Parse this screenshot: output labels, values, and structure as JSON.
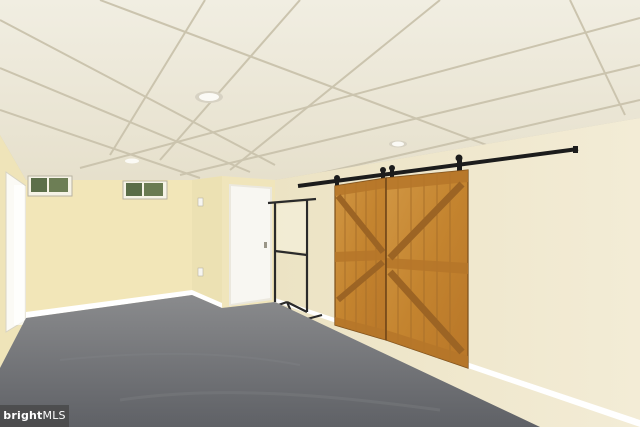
{
  "watermark": {
    "brand": "bright",
    "suffix": "MLS"
  },
  "colors": {
    "ceiling": "#eeeadb",
    "ceiling_grid": "#cfc8b3",
    "wall_back": "#f2e6b8",
    "wall_right": "#efe7cc",
    "floor": "#6e7074",
    "barn_door_wood": "#c98a3a",
    "door_white": "#f7f6f1",
    "rail_black": "#1c1c1c"
  },
  "icons": [
    "ceiling-light-icon",
    "barn-door-hardware-icon"
  ]
}
